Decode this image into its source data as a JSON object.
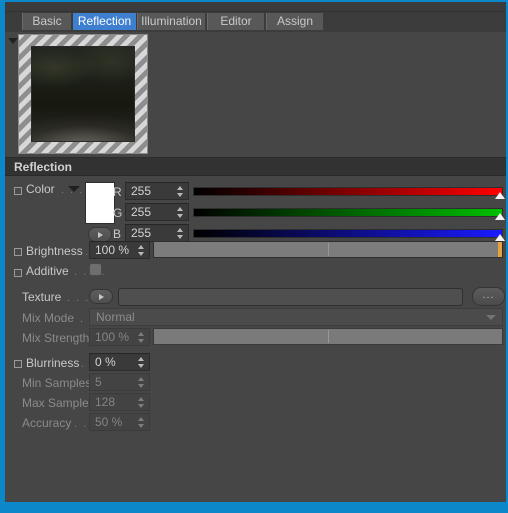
{
  "window": {
    "accent_color": "#0c88ca",
    "panel_bg": "#464646"
  },
  "tabs": [
    {
      "label": "Basic",
      "active": false
    },
    {
      "label": "Reflection",
      "active": true
    },
    {
      "label": "Illumination",
      "active": false
    },
    {
      "label": "Editor",
      "active": false
    },
    {
      "label": "Assign",
      "active": false
    }
  ],
  "preview": {
    "name": "material-preview"
  },
  "section": {
    "title": "Reflection"
  },
  "color": {
    "label": "Color",
    "leader": ". . .",
    "swatch_color": "#ffffff",
    "channels": [
      {
        "name": "R",
        "value": "255"
      },
      {
        "name": "G",
        "value": "255"
      },
      {
        "name": "B",
        "value": "255"
      }
    ]
  },
  "brightness": {
    "label": "Brightness",
    "leader": ". .",
    "value": "100 %"
  },
  "additive": {
    "label": "Additive",
    "leader": ". . . .",
    "checked": false
  },
  "texture": {
    "label": "Texture",
    "leader": ". . . .",
    "value": "",
    "browse_label": "..."
  },
  "mix_mode": {
    "label": "Mix Mode",
    "leader": ". . .",
    "value": "Normal",
    "disabled": true
  },
  "mix_strength": {
    "label": "Mix Strength",
    "value": "100 %",
    "disabled": true
  },
  "blurriness": {
    "label": "Blurriness",
    "leader": ". . .",
    "value": "0 %"
  },
  "min_samples": {
    "label": "Min Samples",
    "value": "5",
    "disabled": true
  },
  "max_samples": {
    "label": "Max Samples",
    "value": "128",
    "disabled": true
  },
  "accuracy": {
    "label": "Accuracy",
    "leader": ". . .",
    "value": "50 %",
    "disabled": true
  }
}
